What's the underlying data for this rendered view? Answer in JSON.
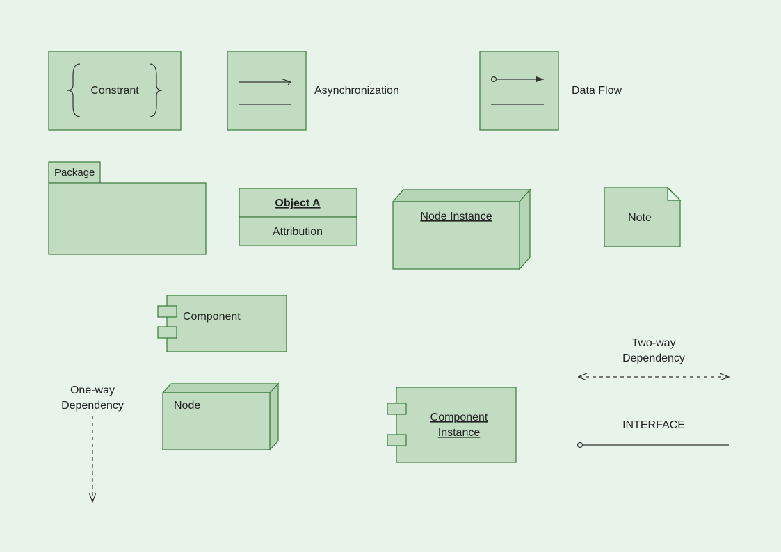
{
  "constraint": {
    "label": "Constrant"
  },
  "async": {
    "label": "Asynchronization"
  },
  "dataflow": {
    "label": "Data Flow"
  },
  "package": {
    "label": "Package"
  },
  "object": {
    "title": "Object A",
    "attr": "Attribution"
  },
  "nodeInstance": {
    "label": "Node Instance"
  },
  "note": {
    "label": "Note"
  },
  "component": {
    "label": "Component"
  },
  "oneWay": {
    "line1": "One-way",
    "line2": "Dependency"
  },
  "node": {
    "label": "Node"
  },
  "componentInstance": {
    "line1": "Component",
    "line2": "Instance"
  },
  "twoWay": {
    "line1": "Two-way",
    "line2": "Dependency"
  },
  "interface": {
    "label": "INTERFACE"
  }
}
